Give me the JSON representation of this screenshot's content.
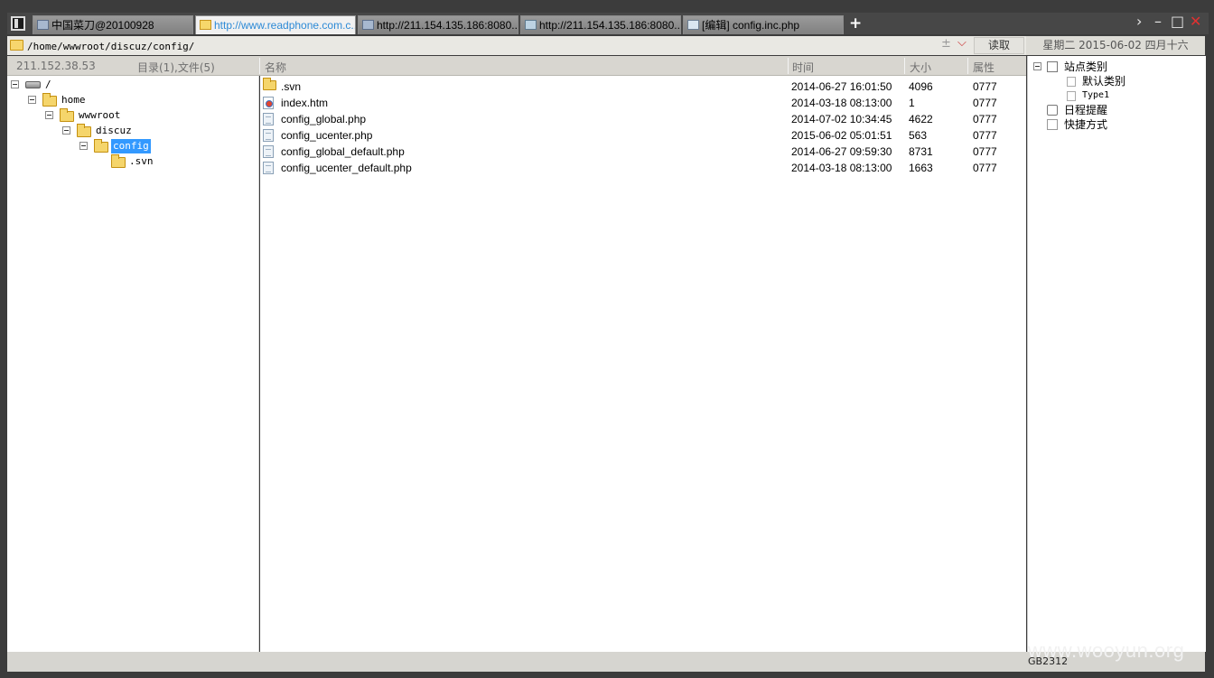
{
  "tabs": [
    {
      "label": "中国菜刀@20100928",
      "icon": "page-icon"
    },
    {
      "label": "http://www.readphone.com.c...",
      "icon": "folder-icon"
    },
    {
      "label": "http://211.154.135.186:8080...",
      "icon": "page-icon"
    },
    {
      "label": "http://211.154.135.186:8080...",
      "icon": "folder-icon"
    },
    {
      "label": "[编辑] config.inc.php",
      "icon": "file-icon"
    }
  ],
  "tab_add": "+",
  "window_controls": {
    "next": "›",
    "minimize": "–",
    "maximize": "□",
    "close": "✕"
  },
  "address": {
    "path": "/home/wwwroot/discuz/config/",
    "plus": "±",
    "dropdown": "⌵",
    "read_label": "读取"
  },
  "date_text": "星期二 2015-06-02 四月十六",
  "left_header": {
    "ip": "211.152.38.53",
    "summary": "目录(1),文件(5)"
  },
  "columns": {
    "name": "名称",
    "time": "时间",
    "size": "大小",
    "attr": "属性"
  },
  "tree": [
    {
      "label": "/",
      "icon": "drive-icon"
    },
    {
      "label": "home",
      "icon": "folder-icon"
    },
    {
      "label": "wwwroot",
      "icon": "folder-icon"
    },
    {
      "label": "discuz",
      "icon": "folder-icon"
    },
    {
      "label": "config",
      "icon": "folder-icon",
      "selected": true
    },
    {
      "label": ".svn",
      "icon": "folder-icon"
    }
  ],
  "files": [
    {
      "name": ".svn",
      "time": "2014-06-27 16:01:50",
      "size": "4096",
      "attr": "0777",
      "icon": "folder-icon"
    },
    {
      "name": "index.htm",
      "time": "2014-03-18 08:13:00",
      "size": "1",
      "attr": "0777",
      "icon": "html-file-icon"
    },
    {
      "name": "config_global.php",
      "time": "2014-07-02 10:34:45",
      "size": "4622",
      "attr": "0777",
      "icon": "php-file-icon"
    },
    {
      "name": "config_ucenter.php",
      "time": "2015-06-02 05:01:51",
      "size": "563",
      "attr": "0777",
      "icon": "php-file-icon"
    },
    {
      "name": "config_global_default.php",
      "time": "2014-06-27 09:59:30",
      "size": "8731",
      "attr": "0777",
      "icon": "php-file-icon"
    },
    {
      "name": "config_ucenter_default.php",
      "time": "2014-03-18 08:13:00",
      "size": "1663",
      "attr": "0777",
      "icon": "php-file-icon"
    }
  ],
  "right_tree": [
    {
      "label": "站点类别",
      "icon": "site-icon"
    },
    {
      "label": "默认类别",
      "icon": "page-icon"
    },
    {
      "label": "Type1",
      "icon": "page-icon"
    },
    {
      "label": "日程提醒",
      "icon": "schedule-icon"
    },
    {
      "label": "快捷方式",
      "icon": "shortcut-icon"
    }
  ],
  "status": {
    "encoding": "GB2312"
  },
  "watermark": "www.wooyun.org"
}
